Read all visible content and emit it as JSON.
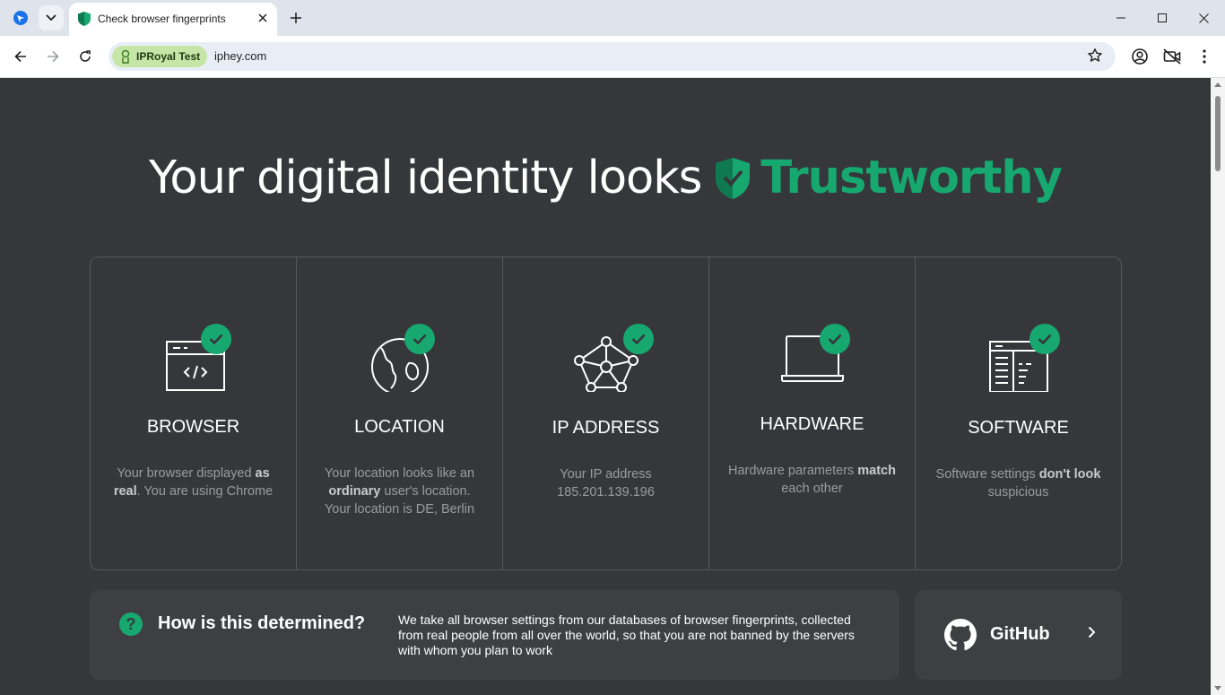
{
  "browser": {
    "tab_title": "Check browser fingerprints",
    "profile_chip": "IPRoyal Test",
    "url": "iphey.com"
  },
  "hero": {
    "prefix": "Your digital identity looks",
    "verdict": "Trustworthy",
    "accent_color": "#17a870"
  },
  "cards": [
    {
      "title": "BROWSER",
      "icon": "browser-code-icon",
      "desc_html": "Your browser displayed <b>as real</b>. You are using Chrome"
    },
    {
      "title": "LOCATION",
      "icon": "globe-icon",
      "desc_html": "Your location looks like an <b>ordinary</b> user's location. Your location is DE, Berlin"
    },
    {
      "title": "IP ADDRESS",
      "icon": "network-icon",
      "desc_html": "Your IP address 185.201.139.196"
    },
    {
      "title": "HARDWARE",
      "icon": "laptop-icon",
      "desc_html": "Hardware parameters <b>match</b> each other"
    },
    {
      "title": "SOFTWARE",
      "icon": "software-window-icon",
      "desc_html": "Software settings <b>don't look</b> suspicious"
    }
  ],
  "how": {
    "title": "How is this determined?",
    "text": "We take all browser settings from our databases of browser fingerprints, collected from real people from all over the world, so that you are not banned by the servers with whom you plan to work"
  },
  "github": {
    "label": "GitHub"
  }
}
